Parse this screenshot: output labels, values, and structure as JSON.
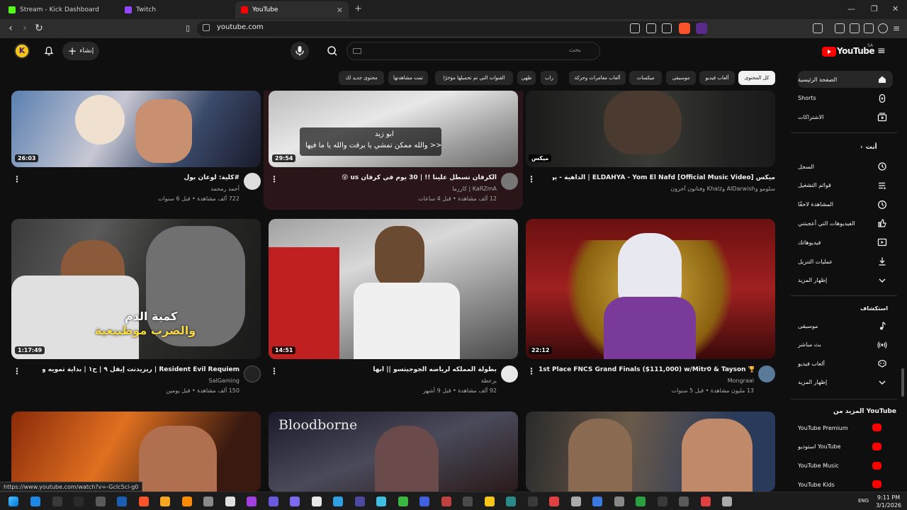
{
  "browser": {
    "tabs": [
      {
        "title": "Stream - Kick Dashboard",
        "color": "#53fc18"
      },
      {
        "title": "Twitch",
        "color": "#9146ff"
      },
      {
        "title": "YouTube",
        "color": "#ff0000"
      }
    ],
    "url": "youtube.com",
    "status_url": "https://www.youtube.com/watch?v=-GcIc5ci-g0"
  },
  "youtube": {
    "logo_text": "YouTube",
    "region": "SA",
    "search_placeholder": "بحث",
    "create_label": "إنشاء",
    "chips": [
      {
        "label": "كل المحتوى",
        "selected": true
      },
      {
        "label": "ألعاب فيديو"
      },
      {
        "label": "موسيقى"
      },
      {
        "label": "ميكسات"
      },
      {
        "label": "ألعاب مغامرات وحركة"
      },
      {
        "label": "راب"
      },
      {
        "label": "طهي"
      },
      {
        "label": "القنوات التي تم تحميلها مؤخرًا"
      },
      {
        "label": "تمت مشاهدتها"
      },
      {
        "label": "محتوى جديد لك"
      }
    ],
    "videos": [
      {
        "title": "#كلية: لوعان بول",
        "channel": "أحمد رمحمد",
        "meta": "722 ألف مشاهدة • قبل 6 سنوات",
        "duration": "26:03",
        "verified": true
      },
      {
        "title": "الكرفان تسطل علينا !! | 30 يوم في كرفان us 😵",
        "channel": "KaRZmA | كارزما",
        "meta": "12 ألف مشاهدة • قبل 4 ساعات",
        "duration": "29:54",
        "thumb_caption_1": "ابو زيد",
        "thumb_caption_2": "<< والله ممكن تمشي يا برقت والله يا ما فيها"
      },
      {
        "title": "ميكس ELDAHYA - Yom El Nafd [Official Music Video] | الداهية - يوم النفض",
        "channel": "سلومو وAlDarwish وKhalz وفنانون آخرون",
        "meta": "",
        "duration": "ميكس"
      },
      {
        "title": "Resident Evil Requiem | ريزيدنت إيفل ٩ | ح١ | بداية تمويه ورعب الف",
        "channel": "SalGaming",
        "meta": "150 ألف مشاهدة • قبل يومين",
        "duration": "1:17:49",
        "thumb_caption_1": "كمية الدم",
        "thumb_caption_2": "والضرب موطبيعية"
      },
      {
        "title": "بطولة المملكه لرياضه الجوجيتسو || ابها",
        "channel": "برعطة",
        "meta": "92 ألف مشاهدة • قبل 9 أشهر",
        "duration": "14:51"
      },
      {
        "title": "1st Place FNCS Grand Finals ($111,000) w/Mitr0 & Tayson 🏆",
        "channel": "Mongraal",
        "meta": "13 مليون مشاهدة • قبل 5 سنوات",
        "duration": "22:12",
        "verified": true
      },
      {
        "title": "",
        "channel": "",
        "meta": "",
        "duration": ""
      },
      {
        "title": "Bloodborne",
        "channel": "",
        "meta": "",
        "duration": ""
      },
      {
        "title": "",
        "channel": "",
        "meta": "",
        "duration": ""
      }
    ],
    "sidebar": {
      "main": [
        {
          "label": "الصفحة الرئيسية",
          "icon": "home-icon",
          "selected": true
        },
        {
          "label": "Shorts",
          "icon": "shorts-icon"
        },
        {
          "label": "الاشتراكات",
          "icon": "subscriptions-icon"
        }
      ],
      "you_heading": "أنت",
      "you": [
        {
          "label": "السجل",
          "icon": "history-icon"
        },
        {
          "label": "قوائم التشغيل",
          "icon": "playlists-icon"
        },
        {
          "label": "المشاهدة لاحقًا",
          "icon": "clock-icon"
        },
        {
          "label": "الفيديوهات التي أعجبتني",
          "icon": "thumbs-up-icon"
        },
        {
          "label": "فيديوهاتك",
          "icon": "your-videos-icon"
        },
        {
          "label": "عمليات التنزيل",
          "icon": "download-icon"
        },
        {
          "label": "إظهار المزيد",
          "icon": "chevron-down-icon"
        }
      ],
      "explore_heading": "استكشاف",
      "explore": [
        {
          "label": "موسيقى",
          "icon": "music-icon"
        },
        {
          "label": "بث مباشر",
          "icon": "live-icon"
        },
        {
          "label": "ألعاب فيديو",
          "icon": "gaming-icon"
        },
        {
          "label": "إظهار المزيد",
          "icon": "chevron-down-icon"
        }
      ],
      "more_heading": "المزيد من YouTube",
      "more": [
        {
          "label": "YouTube Premium",
          "icon": "youtube-premium-icon"
        },
        {
          "label": "استوديو YouTube",
          "icon": "youtube-studio-icon"
        },
        {
          "label": "YouTube Music",
          "icon": "youtube-music-icon"
        },
        {
          "label": "YouTube Kids",
          "icon": "youtube-kids-icon"
        }
      ]
    }
  },
  "taskbar": {
    "language": "ENG",
    "time": "9:11 PM",
    "date": "3/1/2026"
  }
}
